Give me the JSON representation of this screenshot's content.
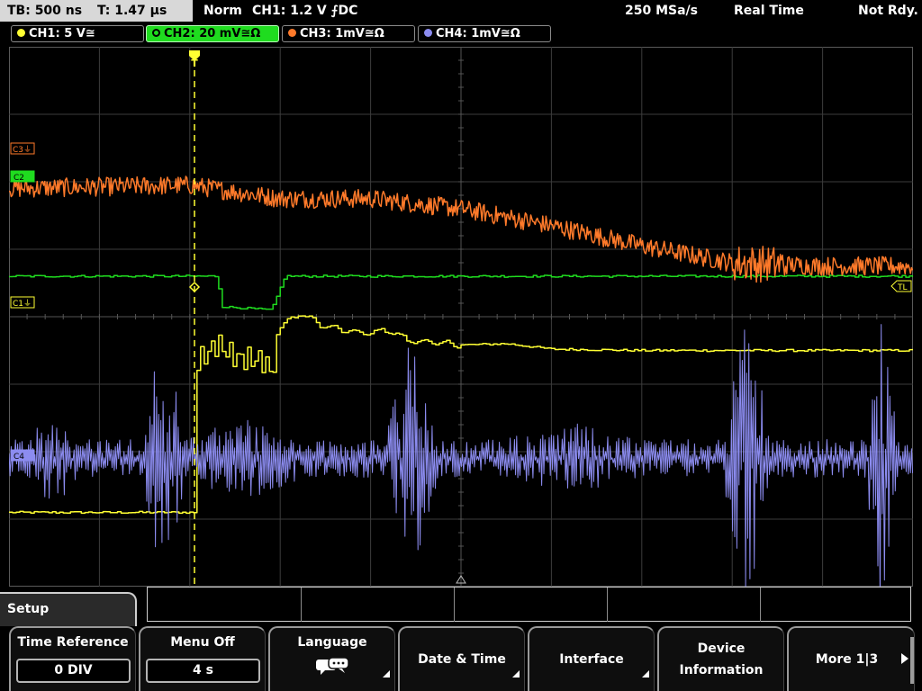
{
  "status": {
    "timebase": "TB: 500 ns",
    "trigger_time": "T: 1.47 µs",
    "mode": "Norm",
    "trigger": "CH1: 1.2 V ⨍DC",
    "sample_rate": "250 MSa/s",
    "acquisition": "Real Time",
    "state": "Not Rdy."
  },
  "channels": [
    {
      "label": "CH1: 5 V≅",
      "color": "#ffff33",
      "active": false
    },
    {
      "label": "CH2: 20 mV≅Ω",
      "color": "#1fdc1f",
      "active": true
    },
    {
      "label": "CH3: 1mV≅Ω",
      "color": "#ff7a2a",
      "active": false
    },
    {
      "label": "CH4: 1mV≅Ω",
      "color": "#8c8cf0",
      "active": false
    }
  ],
  "screen": {
    "markers": {
      "c3": "C3⏚",
      "c2": "C2",
      "c1": "C1⏚",
      "c4": "C4",
      "trigger_level": "TL",
      "trigger_pos": "T"
    }
  },
  "chart_data": {
    "type": "line",
    "x_divisions": 10,
    "y_divisions": 8,
    "grid": true,
    "series": [
      {
        "name": "CH1",
        "color": "#ffff33",
        "points": [
          [
            0,
            1.1
          ],
          [
            2.05,
            1.1
          ],
          [
            2.05,
            3.3
          ],
          [
            2.3,
            3.6
          ],
          [
            2.5,
            3.4
          ],
          [
            2.8,
            3.35
          ],
          [
            2.9,
            3.15
          ],
          [
            3.0,
            3.85
          ],
          [
            3.2,
            4.05
          ],
          [
            3.5,
            3.85
          ],
          [
            3.9,
            3.75
          ],
          [
            4.2,
            3.8
          ],
          [
            4.4,
            3.65
          ],
          [
            5.0,
            3.58
          ],
          [
            5.5,
            3.6
          ],
          [
            6.0,
            3.52
          ],
          [
            7.0,
            3.5
          ],
          [
            8.0,
            3.5
          ],
          [
            9.0,
            3.5
          ],
          [
            10.0,
            3.5
          ]
        ]
      },
      {
        "name": "CH2",
        "color": "#1fdc1f",
        "points": [
          [
            0,
            4.6
          ],
          [
            2.3,
            4.6
          ],
          [
            2.35,
            4.15
          ],
          [
            2.9,
            4.1
          ],
          [
            3.05,
            4.6
          ],
          [
            10.0,
            4.6
          ]
        ]
      },
      {
        "name": "CH3",
        "color": "#ff7a2a",
        "points": [
          [
            0,
            5.9
          ],
          [
            2.0,
            5.95
          ],
          [
            3.0,
            5.75
          ],
          [
            4.0,
            5.75
          ],
          [
            5.0,
            5.6
          ],
          [
            6.0,
            5.35
          ],
          [
            7.0,
            5.05
          ],
          [
            8.0,
            4.8
          ],
          [
            9.0,
            4.75
          ],
          [
            10.0,
            4.75
          ]
        ]
      },
      {
        "name": "CH4",
        "color": "#8c8cf0",
        "points": [
          [
            0,
            1.9
          ],
          [
            1.0,
            1.9
          ],
          [
            1.8,
            1.9
          ],
          [
            4.5,
            1.9
          ],
          [
            6.0,
            1.9
          ],
          [
            8.2,
            1.9
          ],
          [
            9.6,
            1.9
          ],
          [
            10.0,
            1.9
          ]
        ]
      }
    ]
  },
  "menu": {
    "title": "Setup"
  },
  "softkeys": [
    {
      "label": "Time Reference",
      "value": "0 DIV"
    },
    {
      "label": "Menu Off",
      "value": "4 s"
    },
    {
      "label": "Language"
    },
    {
      "label": "Date & Time"
    },
    {
      "label": "Interface"
    },
    {
      "label": "Device",
      "label2": "Information"
    },
    {
      "label": "More 1|3"
    }
  ]
}
